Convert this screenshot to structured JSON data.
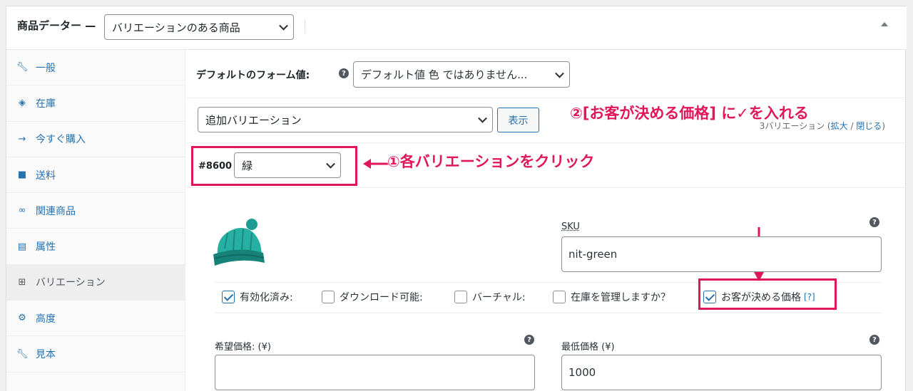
{
  "header": {
    "title": "商品データー —",
    "product_type": "バリエーションのある商品"
  },
  "sidebar": {
    "items": [
      {
        "label": "一般",
        "icon": "wrench-icon"
      },
      {
        "label": "在庫",
        "icon": "tag-icon"
      },
      {
        "label": "今すぐ購入",
        "icon": "circle-arrow-icon"
      },
      {
        "label": "送料",
        "icon": "truck-icon"
      },
      {
        "label": "関連商品",
        "icon": "link-icon"
      },
      {
        "label": "属性",
        "icon": "list-icon"
      },
      {
        "label": "バリエーション",
        "icon": "grid-icon"
      },
      {
        "label": "高度",
        "icon": "gear-icon"
      },
      {
        "label": "見本",
        "icon": "wrench-icon"
      }
    ]
  },
  "defaults": {
    "label": "デフォルトのフォーム値:",
    "help": "?",
    "value": "デフォルト値 色 ではありません..."
  },
  "add_row": {
    "select_value": "追加バリエーション",
    "show_button": "表示",
    "count": "3バリエーション (",
    "expand": "拡大",
    "sep": " / ",
    "collapse": "閉じる",
    "close_paren": ")"
  },
  "variation": {
    "id": "#8600",
    "color_value": "緑",
    "sku_label": "SKU",
    "sku_value": "nit-green",
    "options": {
      "enabled": "有効化済み:",
      "downloadable": "ダウンロード可能:",
      "virtual": "バーチャル:",
      "manage_stock": "在庫を管理しますか？",
      "name_your_price": "お客が決める価格",
      "tip": "[?]"
    },
    "want_price_label": "希望価格: (¥)",
    "want_price_value": "",
    "min_price_label": "最低価格 (¥)",
    "min_price_value": "1000"
  },
  "annotations": {
    "step1": "①各バリエーションをクリック",
    "step2": "②[お客が決める価格] に✓を入れる",
    "color": "#e0185a"
  }
}
